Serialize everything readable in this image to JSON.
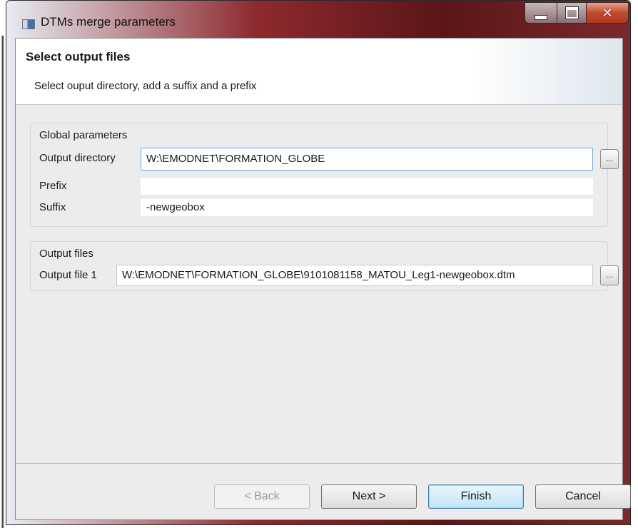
{
  "window": {
    "title": "DTMs merge parameters"
  },
  "header": {
    "title": "Select output files",
    "subtitle": "Select ouput directory, add a suffix and a prefix"
  },
  "global_parameters": {
    "legend": "Global parameters",
    "output_directory_label": "Output directory",
    "output_directory_value": "W:\\EMODNET\\FORMATION_GLOBE",
    "prefix_label": "Prefix",
    "prefix_value": "",
    "suffix_label": "Suffix",
    "suffix_value": "-newgeobox",
    "browse_label": "..."
  },
  "output_files": {
    "legend": "Output files",
    "file1_label": "Output file 1",
    "file1_value": "W:\\EMODNET\\FORMATION_GLOBE\\9101081158_MATOU_Leg1-newgeobox.dtm",
    "browse_label": "..."
  },
  "buttons": {
    "back": "< Back",
    "next": "Next >",
    "finish": "Finish",
    "cancel": "Cancel"
  },
  "icons": [
    "app-icon",
    "minimize-icon",
    "maximize-icon",
    "close-icon"
  ],
  "colors": {
    "titlebar_accent": "#8d2a2f",
    "focus_border": "#7aa7d6",
    "dialog_bg": "#ececec"
  }
}
